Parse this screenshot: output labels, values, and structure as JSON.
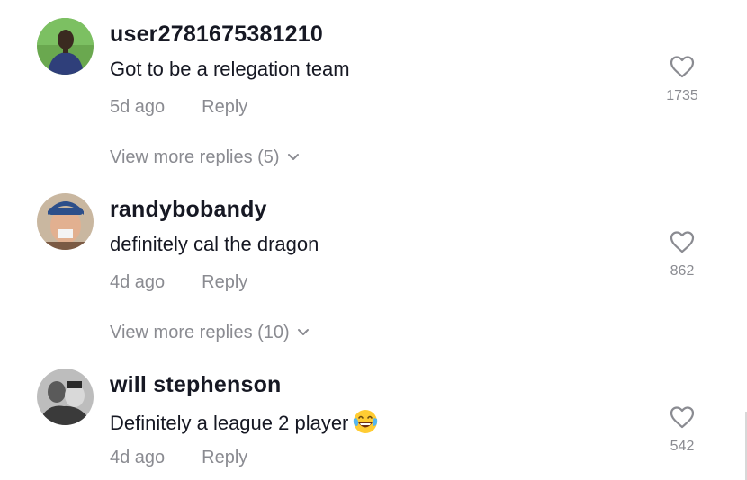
{
  "comments": [
    {
      "username": "user2781675381210",
      "text": "Got to be a relegation team",
      "time": "5d ago",
      "reply_label": "Reply",
      "likes": "1735",
      "view_more": "View more replies (5)",
      "avatar_icon": "avatar-user-photo"
    },
    {
      "username": "randybobandy",
      "text": "definitely cal the dragon",
      "time": "4d ago",
      "reply_label": "Reply",
      "likes": "862",
      "view_more": "View more replies (10)",
      "avatar_icon": "avatar-user-photo"
    },
    {
      "username": "will stephenson",
      "text": "Definitely a league 2 player",
      "time": "4d ago",
      "reply_label": "Reply",
      "likes": "542",
      "emoji": "tears-of-joy-emoji",
      "avatar_icon": "avatar-user-photo"
    }
  ],
  "colors": {
    "primary_text": "#161823",
    "secondary_text": "#8a8b91",
    "background": "#ffffff"
  },
  "icons": {
    "like": "heart-outline-icon",
    "expand": "chevron-down-icon"
  }
}
